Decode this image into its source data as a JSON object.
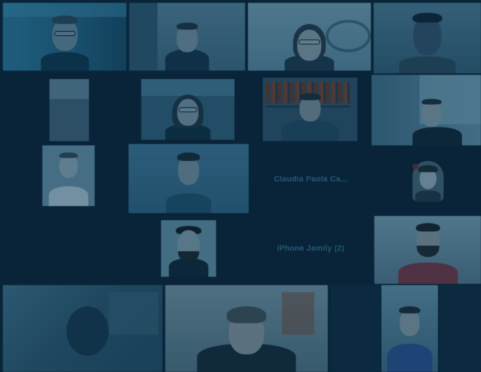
{
  "window": {
    "title": ""
  },
  "gallery": {
    "participants": [
      {
        "id": "p1",
        "name": "",
        "kind": "video"
      },
      {
        "id": "p2",
        "name": "",
        "kind": "video"
      },
      {
        "id": "p3",
        "name": "",
        "kind": "video"
      },
      {
        "id": "p4",
        "name": "",
        "kind": "video"
      },
      {
        "id": "p5",
        "name": "",
        "kind": "video"
      },
      {
        "id": "p6",
        "name": "",
        "kind": "video"
      },
      {
        "id": "p7",
        "name": "",
        "kind": "video"
      },
      {
        "id": "p8",
        "name": "",
        "kind": "video"
      },
      {
        "id": "p9",
        "name": "",
        "kind": "video"
      },
      {
        "id": "p10",
        "name": "",
        "kind": "video"
      },
      {
        "id": "p11",
        "name": "Claudia Paola Ca...",
        "kind": "name-only"
      },
      {
        "id": "p12",
        "name": "",
        "kind": "video"
      },
      {
        "id": "p13",
        "name": "",
        "kind": "video"
      },
      {
        "id": "p14",
        "name": "iPhone Jamily (2)",
        "kind": "name-only"
      },
      {
        "id": "p15",
        "name": "",
        "kind": "video"
      },
      {
        "id": "p16",
        "name": "",
        "kind": "video"
      },
      {
        "id": "p17",
        "name": "",
        "kind": "video"
      },
      {
        "id": "p18",
        "name": "",
        "kind": "video"
      },
      {
        "id": "p19",
        "name": "",
        "kind": "video"
      }
    ]
  },
  "colors": {
    "background": "#0b2438",
    "tile": "#143a55",
    "name_text": "#2f6f8c"
  }
}
